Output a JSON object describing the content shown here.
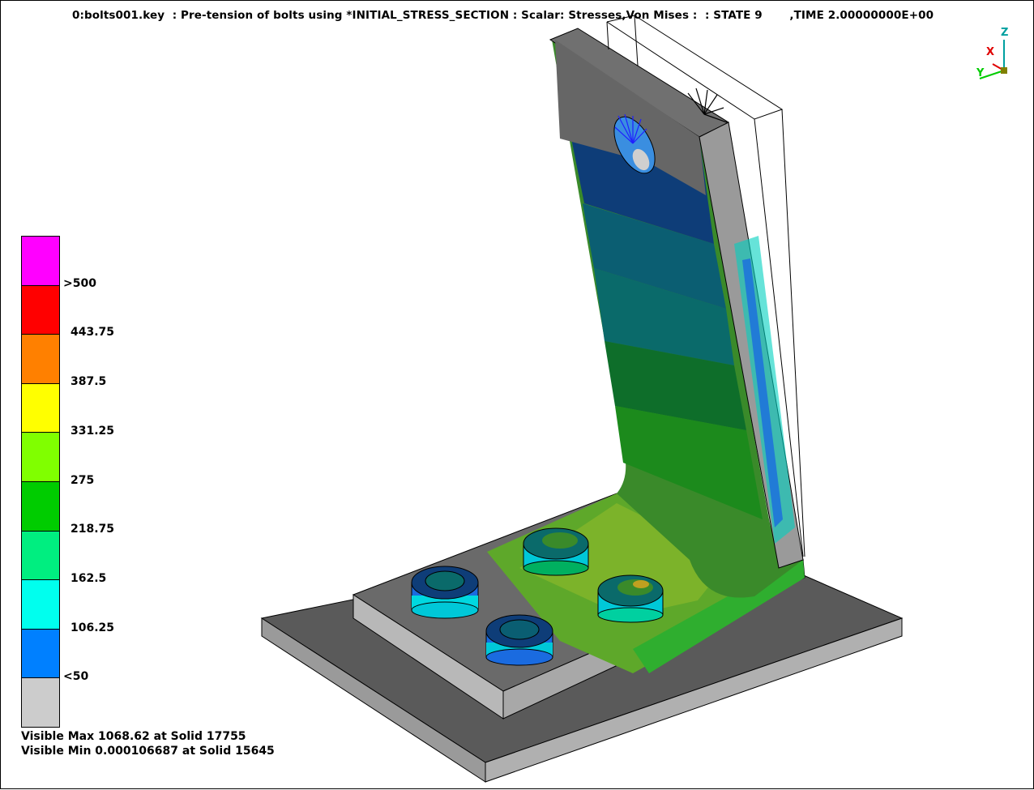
{
  "header": {
    "title": "0:bolts001.key  : Pre-tension of bolts using *INITIAL_STRESS_SECTION : Scalar: Stresses,Von Mises :  : STATE 9       ,TIME 2.00000000E+00"
  },
  "legend": {
    "colors": [
      "#ff00ff",
      "#ff0000",
      "#ff8000",
      "#ffff00",
      "#80ff00",
      "#00cc00",
      "#00ee80",
      "#00ffee",
      "#0080ff",
      "#cccccc"
    ],
    "labels": [
      ">500",
      "443.75",
      "387.5",
      "331.25",
      "275",
      "218.75",
      "162.5",
      "106.25",
      "<50"
    ]
  },
  "info": {
    "max_line": "Visible Max 1068.62 at Solid 17755",
    "min_line": "Visible Min 0.000106687 at Solid 15645"
  },
  "triad": {
    "z_label": "Z",
    "x_label": "X",
    "y_label": "Y",
    "z_color": "#00a0a0",
    "x_color": "#e00000",
    "y_color": "#00cc00"
  }
}
